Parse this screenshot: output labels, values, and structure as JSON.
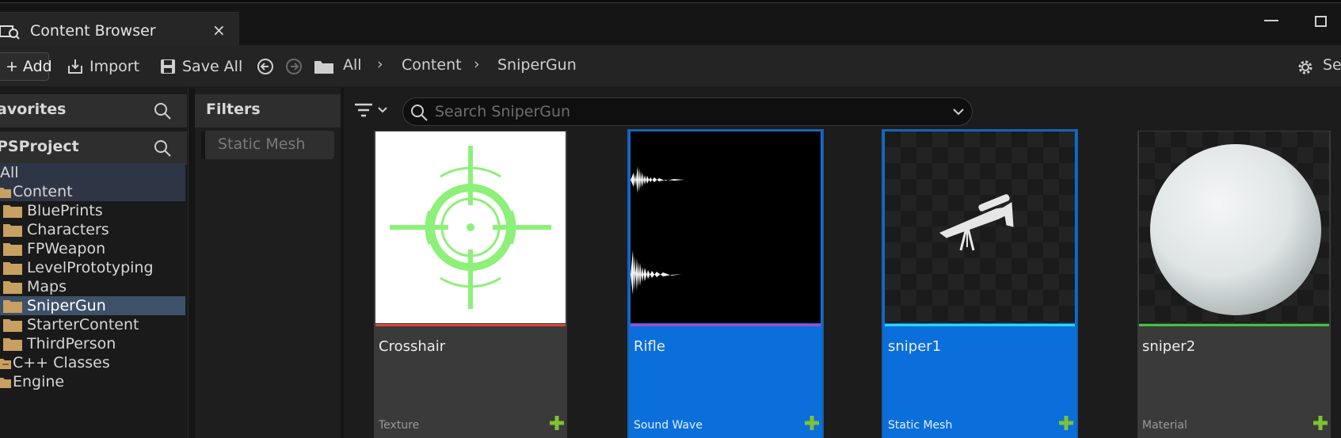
{
  "tab": {
    "title": "Content Browser",
    "close": "×"
  },
  "toolbar": {
    "add_label": "Add",
    "import_label": "Import",
    "saveall_label": "Save All",
    "breadcrumbs": [
      "All",
      "Content",
      "SniperGun"
    ],
    "settings_label": "Se"
  },
  "left": {
    "favorites_label": "avorites",
    "project_label": "PSProject",
    "tree": {
      "all": "All",
      "content": "Content",
      "folders": [
        "BluePrints",
        "Characters",
        "FPWeapon",
        "LevelPrototyping",
        "Maps",
        "SniperGun",
        "StarterContent",
        "ThirdPerson"
      ],
      "cpp": "C++ Classes",
      "engine": "Engine"
    }
  },
  "filters": {
    "label": "Filters",
    "chip": "Static Mesh"
  },
  "search": {
    "placeholder": "Search SniperGun"
  },
  "assets": [
    {
      "name": "Crosshair",
      "type": "Texture",
      "bar_color": "#e0443c"
    },
    {
      "name": "Rifle",
      "type": "Sound Wave",
      "bar_color": "#9b4fd0"
    },
    {
      "name": "sniper1",
      "type": "Static Mesh",
      "bar_color": "#25d8f5"
    },
    {
      "name": "sniper2",
      "type": "Material",
      "bar_color": "#3fc23f"
    }
  ],
  "colors": {
    "accent": "#0a6fdb",
    "selected_folder": "#3d5169",
    "folder": "#c8a062",
    "add_green": "#7fc232"
  }
}
